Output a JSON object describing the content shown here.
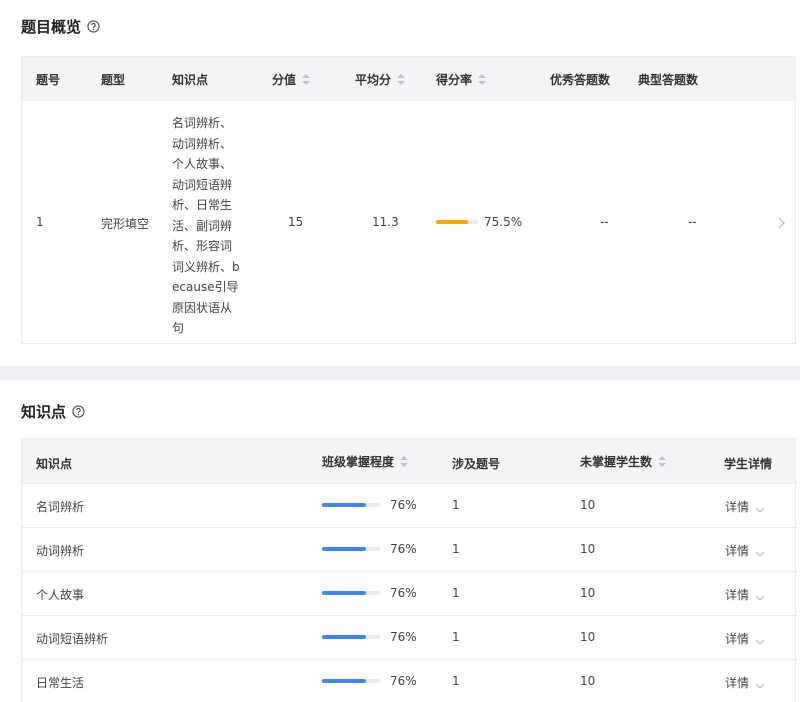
{
  "overview": {
    "title": "题目概览",
    "headers": {
      "no": "题号",
      "type": "题型",
      "knowledge": "知识点",
      "score": "分值",
      "avg": "平均分",
      "rate": "得分率",
      "excellent": "优秀答题数",
      "typical": "典型答题数"
    },
    "row": {
      "no": "1",
      "type": "完形填空",
      "knowledge": "名词辨析、动词辨析、个人故事、动词短语辨析、日常生活、副词辨析、形容词词义辨析、because引导原因状语从句",
      "score": "15",
      "avg": "11.3",
      "rate_text": "75.5%",
      "rate_value": 0.755,
      "excellent": "--",
      "typical": "--"
    },
    "rate_color": "#f5a800"
  },
  "knowledge": {
    "title": "知识点",
    "headers": {
      "name": "知识点",
      "mastery": "班级掌握程度",
      "questions": "涉及题号",
      "unmastered": "未掌握学生数",
      "detail": "学生详情"
    },
    "bar_color": "#3a86f5",
    "rows": [
      {
        "name": "名词辨析",
        "mastery_text": "76%",
        "mastery_value": 0.76,
        "questions": "1",
        "unmastered": "10",
        "detail": "详情"
      },
      {
        "name": "动词辨析",
        "mastery_text": "76%",
        "mastery_value": 0.76,
        "questions": "1",
        "unmastered": "10",
        "detail": "详情"
      },
      {
        "name": "个人故事",
        "mastery_text": "76%",
        "mastery_value": 0.76,
        "questions": "1",
        "unmastered": "10",
        "detail": "详情"
      },
      {
        "name": "动词短语辨析",
        "mastery_text": "76%",
        "mastery_value": 0.76,
        "questions": "1",
        "unmastered": "10",
        "detail": "详情"
      },
      {
        "name": "日常生活",
        "mastery_text": "76%",
        "mastery_value": 0.76,
        "questions": "1",
        "unmastered": "10",
        "detail": "详情"
      }
    ]
  }
}
